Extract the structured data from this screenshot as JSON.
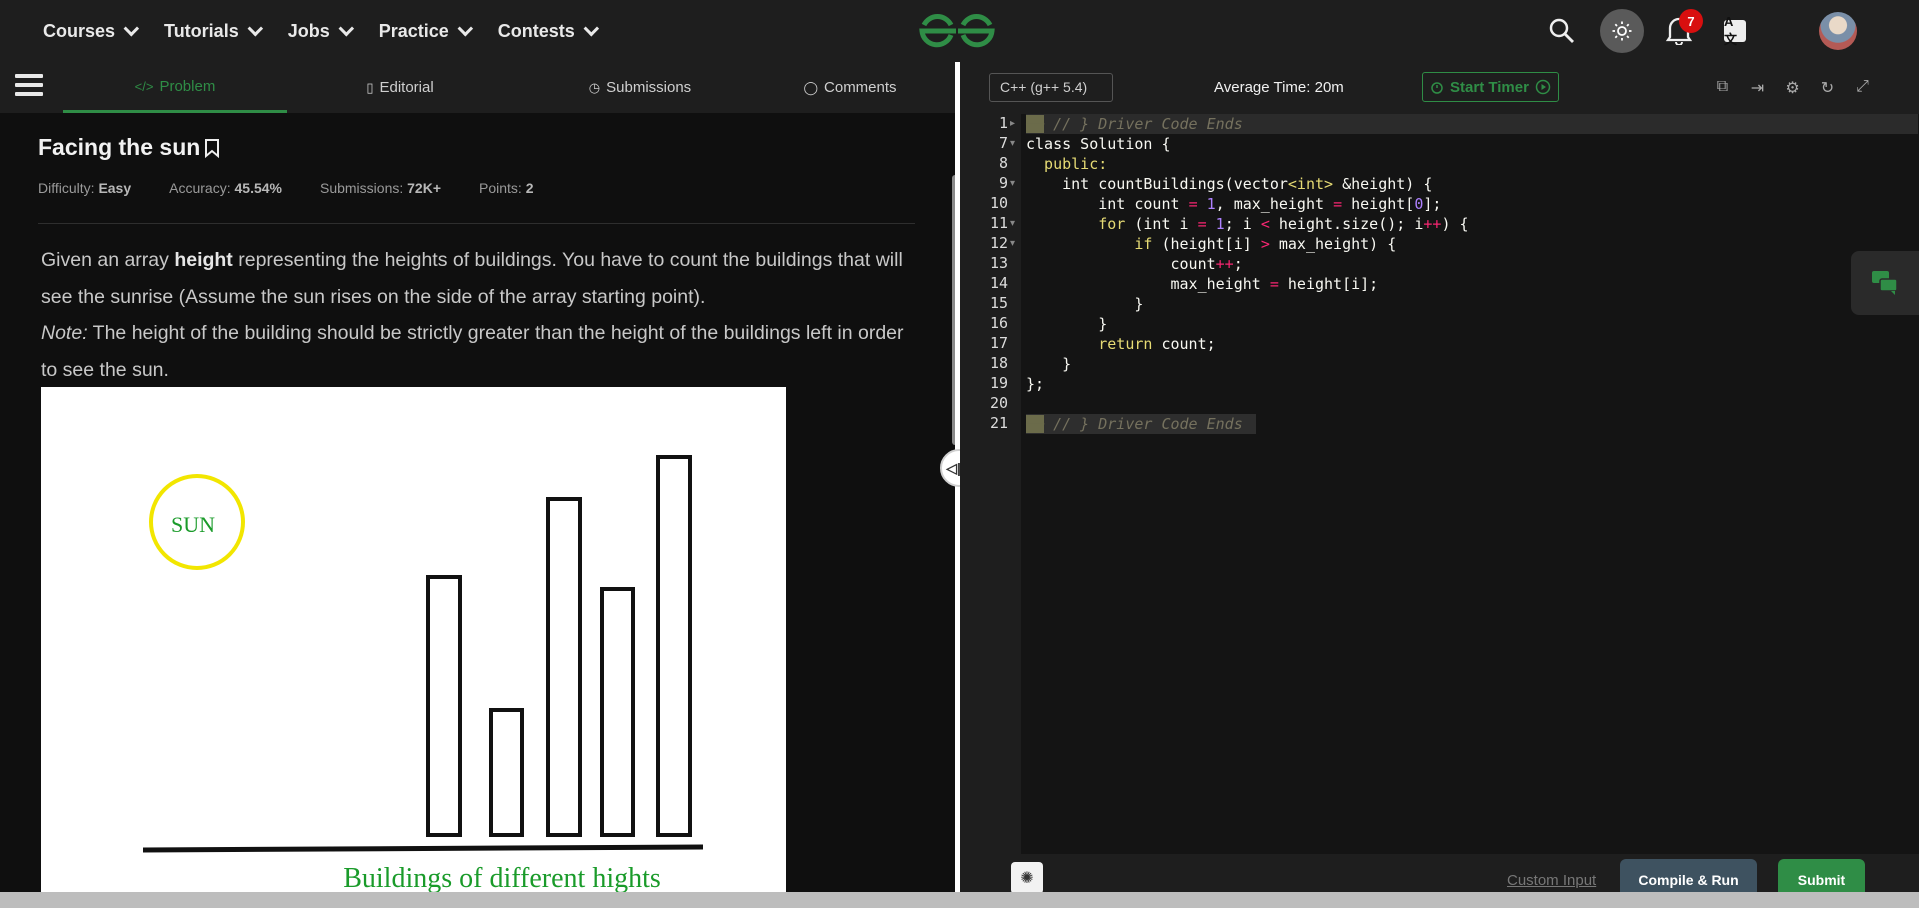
{
  "nav": {
    "items": [
      "Courses",
      "Tutorials",
      "Jobs",
      "Practice",
      "Contests"
    ]
  },
  "topbar": {
    "notifications": "7",
    "translate_label": "A文"
  },
  "tabs": [
    {
      "label": "Problem",
      "icon": "code-icon"
    },
    {
      "label": "Editorial",
      "icon": "document-icon"
    },
    {
      "label": "Submissions",
      "icon": "clock-icon"
    },
    {
      "label": "Comments",
      "icon": "comment-icon"
    }
  ],
  "problem": {
    "title": "Facing the sun",
    "difficulty_label": "Difficulty:",
    "difficulty": "Easy",
    "accuracy_label": "Accuracy:",
    "accuracy": "45.54%",
    "submissions_label": "Submissions:",
    "submissions": "72K+",
    "points_label": "Points:",
    "points": "2",
    "desc_p1_a": "Given an array ",
    "desc_p1_b": "height",
    "desc_p1_c": " representing the heights of buildings. You have to count the buildings that will see the sunrise (Assume the sun rises on the side of the array starting point).",
    "note_label": "Note:",
    "note_text": " The height of the building should be strictly greater than the height of the buildings left in order to see the sun.",
    "figure": {
      "sun_label": "SUN",
      "caption": "Buildings of different hights"
    }
  },
  "editor": {
    "language": "C++ (g++ 5.4)",
    "avg_time": "Average Time: 20m",
    "timer_label": "Start Timer",
    "lines": [
      {
        "n": "1",
        "fold": "▸"
      },
      {
        "n": "7",
        "fold": "▾"
      },
      {
        "n": "8",
        "fold": ""
      },
      {
        "n": "9",
        "fold": "▾"
      },
      {
        "n": "10",
        "fold": ""
      },
      {
        "n": "11",
        "fold": "▾"
      },
      {
        "n": "12",
        "fold": "▾"
      },
      {
        "n": "13",
        "fold": ""
      },
      {
        "n": "14",
        "fold": ""
      },
      {
        "n": "15",
        "fold": ""
      },
      {
        "n": "16",
        "fold": ""
      },
      {
        "n": "17",
        "fold": ""
      },
      {
        "n": "18",
        "fold": ""
      },
      {
        "n": "19",
        "fold": ""
      },
      {
        "n": "20",
        "fold": ""
      },
      {
        "n": "21",
        "fold": ""
      }
    ],
    "code": {
      "l1": "// } Driver Code Ends",
      "l7": "class Solution {",
      "l8": "  public:",
      "l9_a": "    int countBuildings(vector",
      "l9_b": "<int>",
      "l9_c": " &height) {",
      "l10_a": "        int count ",
      "l10_b": "=",
      "l10_c": " ",
      "l10_d": "1",
      "l10_e": ", max_height ",
      "l10_f": "=",
      "l10_g": " height[",
      "l10_h": "0",
      "l10_i": "];",
      "l11_a": "        for",
      "l11_b": " (int i ",
      "l11_c": "=",
      "l11_d": " ",
      "l11_e": "1",
      "l11_f": "; i ",
      "l11_g": "<",
      "l11_h": " height.size(); i",
      "l11_i": "++",
      "l11_j": ") {",
      "l12_a": "            if",
      "l12_b": " (height[i] ",
      "l12_c": ">",
      "l12_d": " max_height) {",
      "l13_a": "                count",
      "l13_b": "++",
      "l13_c": ";",
      "l14_a": "                max_height ",
      "l14_b": "=",
      "l14_c": " height[i];",
      "l15": "            }",
      "l16": "        }",
      "l17_a": "        return",
      "l17_b": " count;",
      "l18": "    }",
      "l19": "};",
      "l20": "",
      "l21": "// } Driver Code Ends"
    },
    "custom_input": "Custom Input",
    "compile_label": "Compile & Run",
    "submit_label": "Submit"
  }
}
